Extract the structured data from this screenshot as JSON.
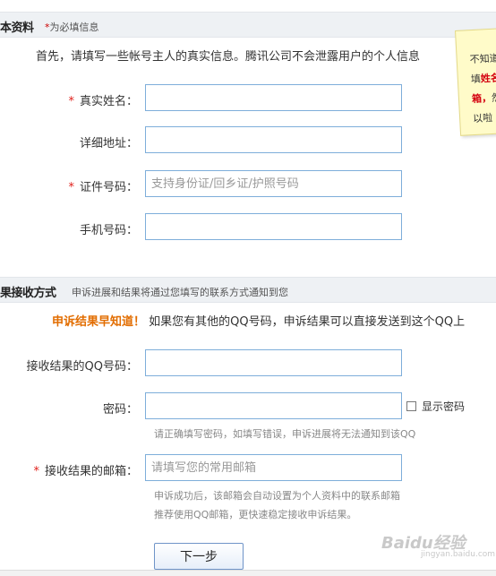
{
  "basic_info": {
    "title": "本资料",
    "required_note_star": "*",
    "required_note": "为必填信息",
    "intro": "首先，请填写一些帐号主人的真实信息。腾讯公司不会泄露用户的个人信息",
    "fields": {
      "real_name": {
        "star": "*",
        "label": "真实姓名：",
        "value": "",
        "placeholder": ""
      },
      "address": {
        "label": "详细地址：",
        "value": "",
        "placeholder": ""
      },
      "id_number": {
        "star": "*",
        "label": "证件号码：",
        "value": "",
        "placeholder": "支持身份证/回乡证/护照号码"
      },
      "phone": {
        "label": "手机号码：",
        "value": "",
        "placeholder": ""
      }
    }
  },
  "sticky_note": {
    "line1": "不知道",
    "line2_prefix": "填",
    "line2_red": "姓名",
    "line3_red": "箱，",
    "line3_suffix": "然",
    "line4": "以啦"
  },
  "result_receive": {
    "title": "果接收方式",
    "subtitle": "申诉进展和结果将通过您填写的联系方式通知到您",
    "promo_highlight": "申诉结果早知道！",
    "promo_text": "如果您有其他的QQ号码，申诉结果可以直接发送到这个QQ上",
    "fields": {
      "qq": {
        "label": "接收结果的QQ号码：",
        "value": "",
        "placeholder": ""
      },
      "password": {
        "label": "密码：",
        "value": "",
        "placeholder": "",
        "tip": "请正确填写密码，如填写错误，申诉进展将无法通知到该QQ"
      },
      "email": {
        "star": "*",
        "label": "接收结果的邮箱：",
        "value": "",
        "placeholder": "请填写您的常用邮箱",
        "tip1": "申诉成功后，该邮箱会自动设置为个人资料中的联系邮箱",
        "tip2": "推荐使用QQ邮箱，更快速稳定接收申诉结果。"
      }
    },
    "show_password_label": "显示密码",
    "show_password_checked": false
  },
  "next_button": "下一步",
  "watermark": {
    "text": "Baidu经验",
    "sub": "jingyan.baidu.com"
  }
}
